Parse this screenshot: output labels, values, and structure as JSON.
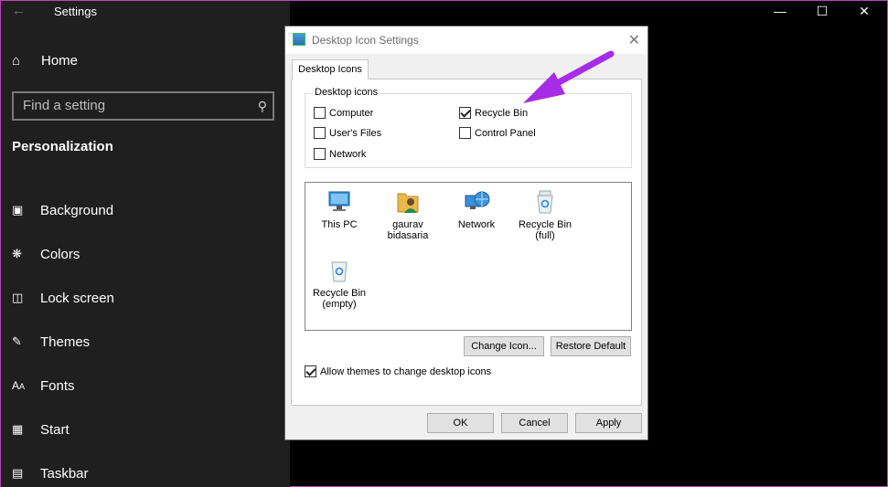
{
  "settings": {
    "title": "Settings",
    "back_icon": "back-arrow-icon",
    "caption": {
      "minimize": "—",
      "maximize": "☐",
      "close": "✕"
    },
    "home_label": "Home",
    "search_placeholder": "Find a setting",
    "section_title": "Personalization",
    "nav_items": [
      {
        "label": "Background",
        "icon": "picture-icon"
      },
      {
        "label": "Colors",
        "icon": "palette-icon"
      },
      {
        "label": "Lock screen",
        "icon": "lock-screen-icon"
      },
      {
        "label": "Themes",
        "icon": "themes-icon"
      },
      {
        "label": "Fonts",
        "icon": "fonts-icon"
      },
      {
        "label": "Start",
        "icon": "start-icon"
      },
      {
        "label": "Taskbar",
        "icon": "taskbar-icon"
      }
    ]
  },
  "dialog": {
    "title": "Desktop Icon Settings",
    "tab_label": "Desktop Icons",
    "group_label": "Desktop icons",
    "checkboxes": {
      "computer": {
        "label": "Computer",
        "checked": false
      },
      "recycle_bin": {
        "label": "Recycle Bin",
        "checked": true
      },
      "users_files": {
        "label": "User's Files",
        "checked": false
      },
      "control_panel": {
        "label": "Control Panel",
        "checked": false
      },
      "network": {
        "label": "Network",
        "checked": false
      }
    },
    "icons": [
      {
        "line1": "This PC",
        "line2": ""
      },
      {
        "line1": "gaurav",
        "line2": "bidasaria"
      },
      {
        "line1": "Network",
        "line2": ""
      },
      {
        "line1": "Recycle Bin",
        "line2": "(full)"
      },
      {
        "line1": "Recycle Bin",
        "line2": "(empty)"
      }
    ],
    "change_icon_label": "Change Icon...",
    "restore_default_label": "Restore Default",
    "allow_themes": {
      "label": "Allow themes to change desktop icons",
      "checked": true
    },
    "ok_label": "OK",
    "cancel_label": "Cancel",
    "apply_label": "Apply"
  },
  "colors": {
    "arrow": "#a62ce6",
    "sidebar": "#1f1f1f",
    "dialog": "#f0f0f0"
  }
}
